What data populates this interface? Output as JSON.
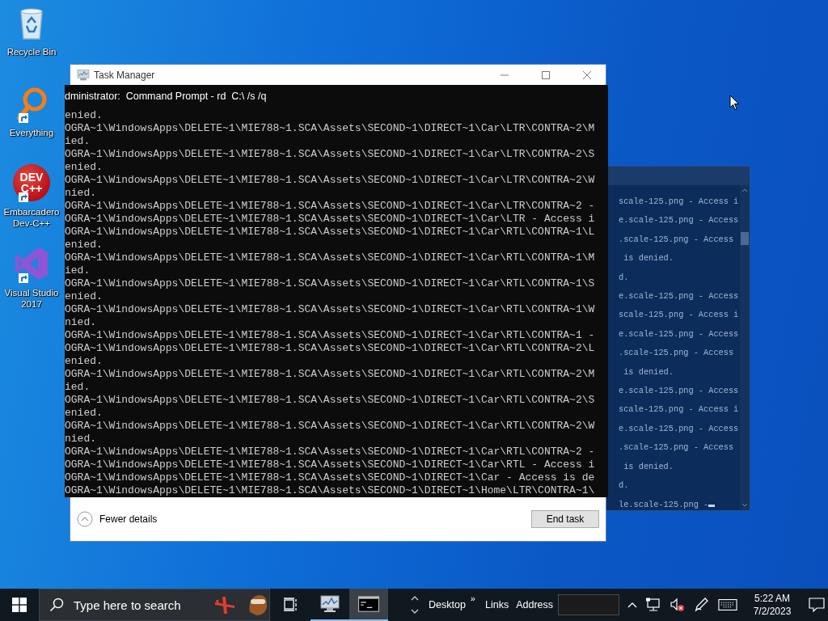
{
  "desktop_icons": [
    {
      "kind": "recycle_bin",
      "label": "Recycle Bin",
      "shortcut": false
    },
    {
      "kind": "magnifier",
      "label": "Everything",
      "shortcut": true
    },
    {
      "kind": "dev_cpp",
      "label": "Embarcadero Dev-C++",
      "logo_text": [
        "DEV",
        "C++"
      ],
      "shortcut": true
    },
    {
      "kind": "visual_studio",
      "label": "Visual Studio 2017",
      "shortcut": true
    }
  ],
  "task_manager": {
    "title": "Task Manager",
    "details_toggle": "Fewer details",
    "end_task_button": "End task"
  },
  "console": {
    "title": "dministrator:  Command Prompt - rd  C:\\ /s /q",
    "lines": [
      "enied.",
      "OGRA~1\\WindowsApps\\DELETE~1\\MIE788~1.SCA\\Assets\\SECOND~1\\DIRECT~1\\Car\\LTR\\CONTRA~2\\M",
      "ied.",
      "OGRA~1\\WindowsApps\\DELETE~1\\MIE788~1.SCA\\Assets\\SECOND~1\\DIRECT~1\\Car\\LTR\\CONTRA~2\\S",
      "enied.",
      "OGRA~1\\WindowsApps\\DELETE~1\\MIE788~1.SCA\\Assets\\SECOND~1\\DIRECT~1\\Car\\LTR\\CONTRA~2\\W",
      "nied.",
      "OGRA~1\\WindowsApps\\DELETE~1\\MIE788~1.SCA\\Assets\\SECOND~1\\DIRECT~1\\Car\\LTR\\CONTRA~2 -",
      "OGRA~1\\WindowsApps\\DELETE~1\\MIE788~1.SCA\\Assets\\SECOND~1\\DIRECT~1\\Car\\LTR - Access i",
      "OGRA~1\\WindowsApps\\DELETE~1\\MIE788~1.SCA\\Assets\\SECOND~1\\DIRECT~1\\Car\\RTL\\CONTRA~1\\L",
      "enied.",
      "OGRA~1\\WindowsApps\\DELETE~1\\MIE788~1.SCA\\Assets\\SECOND~1\\DIRECT~1\\Car\\RTL\\CONTRA~1\\M",
      "ied.",
      "OGRA~1\\WindowsApps\\DELETE~1\\MIE788~1.SCA\\Assets\\SECOND~1\\DIRECT~1\\Car\\RTL\\CONTRA~1\\S",
      "enied.",
      "OGRA~1\\WindowsApps\\DELETE~1\\MIE788~1.SCA\\Assets\\SECOND~1\\DIRECT~1\\Car\\RTL\\CONTRA~1\\W",
      "nied.",
      "OGRA~1\\WindowsApps\\DELETE~1\\MIE788~1.SCA\\Assets\\SECOND~1\\DIRECT~1\\Car\\RTL\\CONTRA~1 -",
      "OGRA~1\\WindowsApps\\DELETE~1\\MIE788~1.SCA\\Assets\\SECOND~1\\DIRECT~1\\Car\\RTL\\CONTRA~2\\L",
      "enied.",
      "OGRA~1\\WindowsApps\\DELETE~1\\MIE788~1.SCA\\Assets\\SECOND~1\\DIRECT~1\\Car\\RTL\\CONTRA~2\\M",
      "ied.",
      "OGRA~1\\WindowsApps\\DELETE~1\\MIE788~1.SCA\\Assets\\SECOND~1\\DIRECT~1\\Car\\RTL\\CONTRA~2\\S",
      "enied.",
      "OGRA~1\\WindowsApps\\DELETE~1\\MIE788~1.SCA\\Assets\\SECOND~1\\DIRECT~1\\Car\\RTL\\CONTRA~2\\W",
      "nied.",
      "OGRA~1\\WindowsApps\\DELETE~1\\MIE788~1.SCA\\Assets\\SECOND~1\\DIRECT~1\\Car\\RTL\\CONTRA~2 -",
      "OGRA~1\\WindowsApps\\DELETE~1\\MIE788~1.SCA\\Assets\\SECOND~1\\DIRECT~1\\Car\\RTL - Access i",
      "OGRA~1\\WindowsApps\\DELETE~1\\MIE788~1.SCA\\Assets\\SECOND~1\\DIRECT~1\\Car - Access is de",
      "OGRA~1\\WindowsApps\\DELETE~1\\MIE788~1.SCA\\Assets\\SECOND~1\\DIRECT~1\\Home\\LTR\\CONTRA~1\\"
    ]
  },
  "background_console": {
    "lines": [
      "scale-125.png - Access i",
      "e.scale-125.png - Access",
      ".scale-125.png - Access",
      " is denied.",
      "d.",
      "e.scale-125.png - Access",
      "scale-125.png - Access i",
      "e.scale-125.png - Access",
      ".scale-125.png - Access",
      " is denied.",
      "e.scale-125.png - Access",
      "scale-125.png - Access i",
      "e.scale-125.png - Access",
      ".scale-125.png - Access",
      " is denied.",
      "d.",
      "le.scale-125.png -"
    ]
  },
  "taskbar": {
    "search_placeholder": "Type here to search",
    "apps": [
      {
        "kind": "task_manager",
        "active": false,
        "running": true
      },
      {
        "kind": "console",
        "active": true,
        "running": true
      }
    ],
    "toolbar_items": [
      "Desktop",
      "Links",
      "Address"
    ],
    "toolbar_chevron": "»",
    "tray_icons": [
      {
        "kind": "network"
      },
      {
        "kind": "volume_muted"
      },
      {
        "kind": "pen"
      },
      {
        "kind": "keyboard"
      }
    ],
    "time": "5:22 AM",
    "date": "7/2/2023"
  }
}
